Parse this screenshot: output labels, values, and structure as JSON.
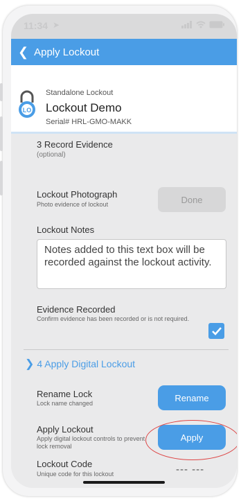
{
  "status_bar": {
    "time": "11:34"
  },
  "nav": {
    "back_label": "Apply Lockout"
  },
  "lock": {
    "type": "Standalone Lockout",
    "name": "Lockout Demo",
    "serial": "Serial# HRL-GMO-MAKK",
    "logo_text": "LO"
  },
  "evidence": {
    "section_title": "3 Record Evidence",
    "section_note": "(optional)",
    "photo_label": "Lockout Photograph",
    "photo_sub": "Photo evidence of lockout",
    "photo_button": "Done",
    "notes_label": "Lockout Notes",
    "notes_text": "Notes added to this text box will be recorded against the lockout activity.",
    "recorded_label": "Evidence Recorded",
    "recorded_sub": "Confirm evidence has been recorded or is not required.",
    "recorded_checked": true
  },
  "digital": {
    "section_title": "4 Apply Digital Lockout",
    "rename_label": "Rename Lock",
    "rename_sub": "Lock name changed",
    "rename_button": "Rename",
    "apply_label": "Apply Lockout",
    "apply_sub": "Apply digital lockout controls to prevent lock removal",
    "apply_button": "Apply",
    "code_label": "Lockout Code",
    "code_sub": "Unique code for this lockout",
    "code_value": "--- ---"
  },
  "colors": {
    "accent": "#4a9de6",
    "annotation": "#dd4444"
  }
}
